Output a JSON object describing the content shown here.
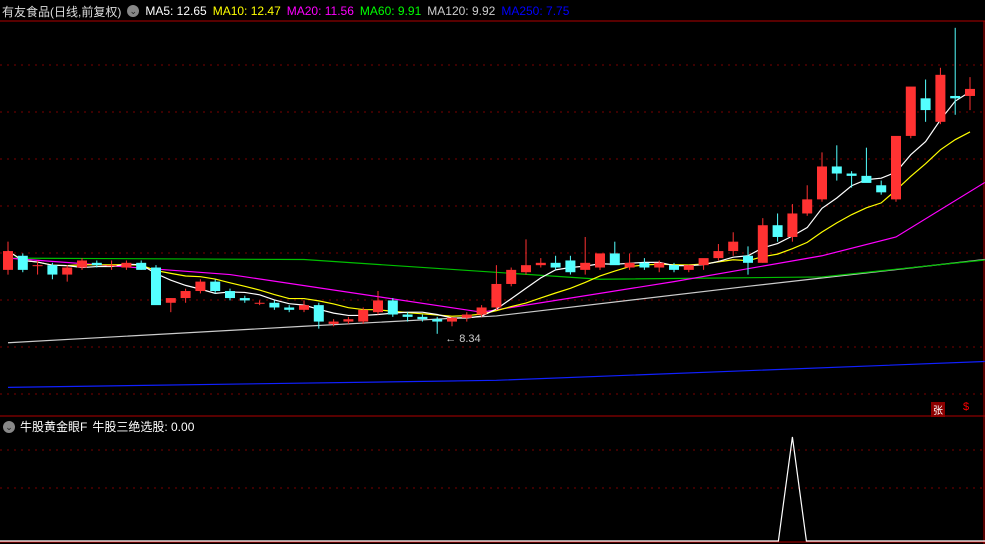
{
  "header": {
    "title": "有友食品(日线,前复权)",
    "ma": [
      {
        "label": "MA5: 12.65",
        "color": "#ffffff"
      },
      {
        "label": "MA10: 12.47",
        "color": "#ffff00"
      },
      {
        "label": "MA20: 11.56",
        "color": "#ff00ff"
      },
      {
        "label": "MA60: 9.91",
        "color": "#00ff00"
      },
      {
        "label": "MA120: 9.92",
        "color": "#cccccc"
      },
      {
        "label": "MA250: 7.75",
        "color": "#0000ff"
      }
    ]
  },
  "low_label": "8.34",
  "indicator": {
    "name": "牛股黄金眼F",
    "value_label": "牛股三绝选股: 0.00",
    "signal_index": 53
  },
  "badges": {
    "zhang": "张",
    "sign": "$"
  },
  "colors": {
    "up": "#ff3232",
    "down": "#54ffff",
    "grid": "#7a0000"
  },
  "chart_data": {
    "type": "candlestick",
    "candles": [
      [
        9.7,
        10.3,
        9.6,
        10.1
      ],
      [
        10.0,
        10.05,
        9.65,
        9.7
      ],
      [
        9.8,
        9.9,
        9.6,
        9.8
      ],
      [
        9.8,
        9.85,
        9.5,
        9.6
      ],
      [
        9.6,
        9.8,
        9.45,
        9.75
      ],
      [
        9.75,
        9.95,
        9.7,
        9.9
      ],
      [
        9.85,
        9.9,
        9.75,
        9.8
      ],
      [
        9.8,
        9.9,
        9.7,
        9.8
      ],
      [
        9.75,
        9.9,
        9.7,
        9.85
      ],
      [
        9.85,
        9.9,
        9.7,
        9.7
      ],
      [
        9.75,
        9.8,
        9.1,
        8.95
      ],
      [
        9.0,
        9.1,
        8.8,
        9.1
      ],
      [
        9.1,
        9.3,
        9.0,
        9.25
      ],
      [
        9.25,
        9.5,
        9.2,
        9.45
      ],
      [
        9.45,
        9.5,
        9.2,
        9.25
      ],
      [
        9.25,
        9.3,
        9.05,
        9.1
      ],
      [
        9.1,
        9.15,
        9.0,
        9.05
      ],
      [
        9.0,
        9.05,
        8.95,
        9.0
      ],
      [
        9.0,
        9.05,
        8.85,
        8.9
      ],
      [
        8.9,
        8.95,
        8.8,
        8.85
      ],
      [
        8.85,
        9.05,
        8.8,
        8.95
      ],
      [
        8.95,
        9.0,
        8.45,
        8.6
      ],
      [
        8.55,
        8.65,
        8.5,
        8.6
      ],
      [
        8.6,
        8.7,
        8.55,
        8.65
      ],
      [
        8.6,
        8.9,
        8.55,
        8.85
      ],
      [
        8.8,
        9.25,
        8.75,
        9.05
      ],
      [
        9.05,
        9.1,
        8.7,
        8.75
      ],
      [
        8.75,
        8.8,
        8.6,
        8.7
      ],
      [
        8.7,
        8.75,
        8.6,
        8.65
      ],
      [
        8.65,
        8.7,
        8.34,
        8.6
      ],
      [
        8.6,
        8.7,
        8.5,
        8.68
      ],
      [
        8.68,
        8.8,
        8.6,
        8.75
      ],
      [
        8.75,
        8.95,
        8.7,
        8.9
      ],
      [
        8.9,
        9.8,
        8.85,
        9.4
      ],
      [
        9.4,
        9.75,
        9.35,
        9.7
      ],
      [
        9.65,
        10.35,
        9.6,
        9.8
      ],
      [
        9.8,
        9.95,
        9.75,
        9.85
      ],
      [
        9.85,
        10.0,
        9.7,
        9.75
      ],
      [
        9.9,
        10.0,
        9.6,
        9.65
      ],
      [
        9.7,
        10.4,
        9.6,
        9.85
      ],
      [
        9.75,
        10.0,
        9.7,
        10.05
      ],
      [
        10.05,
        10.3,
        9.95,
        9.8
      ],
      [
        9.75,
        10.05,
        9.7,
        9.85
      ],
      [
        9.85,
        9.95,
        9.7,
        9.75
      ],
      [
        9.75,
        9.9,
        9.65,
        9.85
      ],
      [
        9.8,
        9.85,
        9.65,
        9.7
      ],
      [
        9.7,
        9.8,
        9.65,
        9.8
      ],
      [
        9.8,
        9.9,
        9.7,
        9.95
      ],
      [
        9.95,
        10.25,
        9.9,
        10.1
      ],
      [
        10.1,
        10.5,
        10.0,
        10.3
      ],
      [
        10.0,
        10.2,
        9.6,
        9.85
      ],
      [
        9.85,
        10.8,
        9.85,
        10.65
      ],
      [
        10.65,
        10.9,
        10.3,
        10.4
      ],
      [
        10.4,
        11.1,
        10.3,
        10.9
      ],
      [
        10.9,
        11.5,
        10.85,
        11.2
      ],
      [
        11.2,
        12.2,
        11.15,
        11.9
      ],
      [
        11.9,
        12.35,
        11.6,
        11.75
      ],
      [
        11.75,
        11.8,
        11.45,
        11.7
      ],
      [
        11.7,
        12.3,
        11.6,
        11.55
      ],
      [
        11.5,
        11.6,
        11.3,
        11.35
      ],
      [
        11.2,
        12.45,
        11.15,
        12.55
      ],
      [
        12.55,
        13.55,
        12.5,
        13.6
      ],
      [
        13.35,
        13.75,
        12.85,
        13.1
      ],
      [
        12.85,
        14.0,
        12.8,
        13.85
      ],
      [
        13.4,
        14.85,
        13.0,
        13.35
      ],
      [
        13.4,
        13.8,
        13.1,
        13.55
      ]
    ],
    "ma60": [
      [
        0,
        9.95
      ],
      [
        20,
        9.92
      ],
      [
        40,
        9.5
      ],
      [
        55,
        9.55
      ],
      [
        66,
        9.91
      ]
    ],
    "ma120": [
      [
        0,
        8.15
      ],
      [
        20,
        8.5
      ],
      [
        33,
        8.72
      ],
      [
        50,
        9.35
      ],
      [
        66,
        9.92
      ]
    ],
    "ma250": [
      [
        0,
        7.2
      ],
      [
        33,
        7.35
      ],
      [
        66,
        7.75
      ]
    ],
    "ma20": [
      [
        0,
        9.95
      ],
      [
        15,
        9.6
      ],
      [
        32,
        8.8
      ],
      [
        45,
        9.45
      ],
      [
        55,
        10.0
      ],
      [
        60,
        10.4
      ],
      [
        66,
        11.56
      ]
    ]
  }
}
